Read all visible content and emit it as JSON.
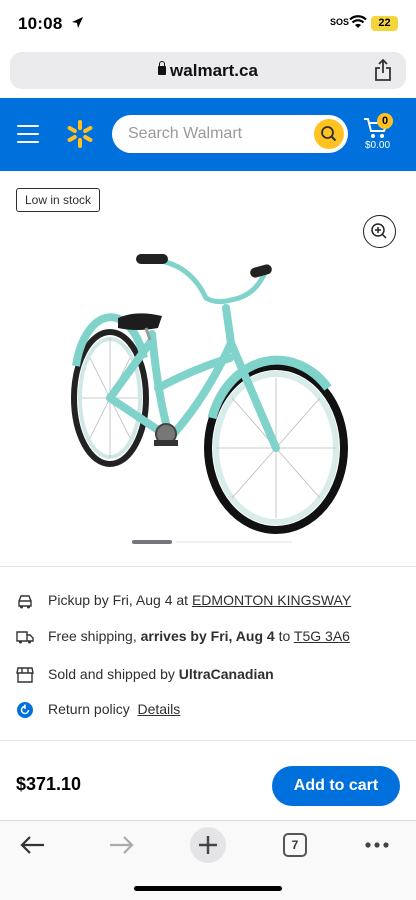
{
  "status_bar": {
    "time": "10:08",
    "sos": "SOS",
    "battery": "22"
  },
  "browser": {
    "url": "walmart.ca",
    "tab_count": "7"
  },
  "header": {
    "search_placeholder": "Search Walmart",
    "cart_count": "0",
    "cart_total": "$0.00",
    "brand_color": "#0071dc",
    "accent_color": "#ffc220"
  },
  "product": {
    "stock_badge": "Low in stock",
    "image_alt": "Teal cruiser bicycle",
    "carousel": {
      "active_index": 1,
      "total": 4
    }
  },
  "fulfillment": {
    "pickup": {
      "prefix": "Pickup by Fri, Aug 4 at",
      "store": "EDMONTON KINGSWAY"
    },
    "shipping": {
      "prefix": "Free shipping,",
      "arrives": "arrives by Fri, Aug 4",
      "to": "to",
      "postal": "T5G 3A6"
    },
    "seller": {
      "prefix": "Sold and shipped by",
      "name": "UltraCanadian"
    },
    "returns": {
      "label": "Return policy",
      "link": "Details"
    }
  },
  "purchase": {
    "price": "$371.10",
    "add_to_cart": "Add to cart"
  }
}
